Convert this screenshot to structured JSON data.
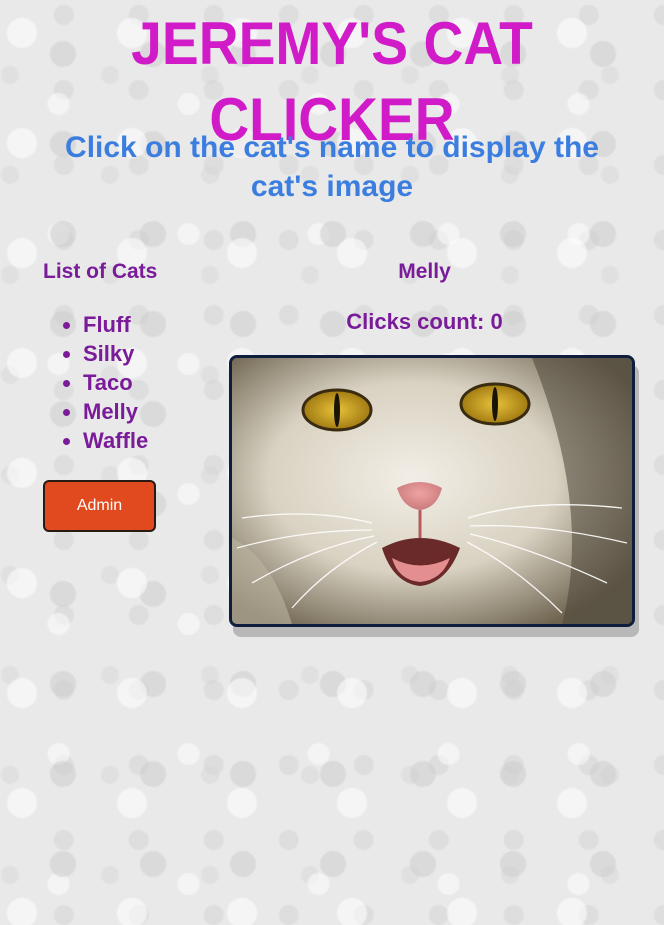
{
  "header": {
    "title": "JEREMY'S CAT CLICKER",
    "subtitle": "Click on the cat's name to display the cat's image"
  },
  "sidebar": {
    "heading": "List of Cats",
    "cats": [
      "Fluff",
      "Silky",
      "Taco",
      "Melly",
      "Waffle"
    ],
    "admin_label": "Admin"
  },
  "main": {
    "cat_name": "Melly",
    "clicks_label": "Clicks count: 0"
  },
  "colors": {
    "title": "#d21bc8",
    "subtitle": "#3b7ee0",
    "text": "#7a1b9a",
    "admin_button": "#e04a1e",
    "image_border": "#0f1e3c"
  }
}
